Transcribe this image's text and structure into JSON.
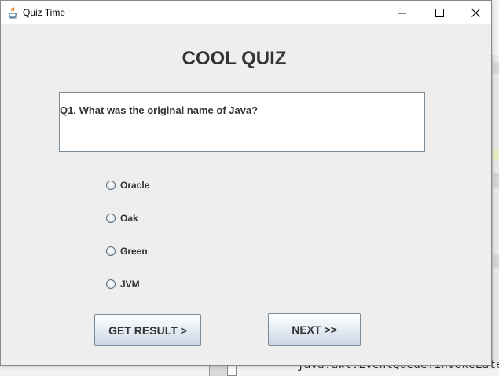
{
  "window": {
    "title": "Quiz Time"
  },
  "quiz": {
    "heading": "COOL QUIZ",
    "question": "Q1. What was the original name of Java?",
    "options": [
      {
        "label": "Oracle",
        "selected": false
      },
      {
        "label": "Oak",
        "selected": false
      },
      {
        "label": "Green",
        "selected": false
      },
      {
        "label": "JVM",
        "selected": false
      }
    ],
    "buttons": {
      "result": "GET RESULT >",
      "next": "NEXT >>"
    }
  },
  "background": {
    "code_fragment": "java.awt.EventQueue.invokeLater(n"
  },
  "colors": {
    "window_bg": "#eeeeee",
    "title_text": "#333333",
    "button_border": "#7a8a99"
  },
  "icons": {
    "app": "java-coffee-cup-icon",
    "minimize": "minimize-icon",
    "maximize": "maximize-icon",
    "close": "close-icon",
    "radio": "radio-button-unchecked"
  }
}
